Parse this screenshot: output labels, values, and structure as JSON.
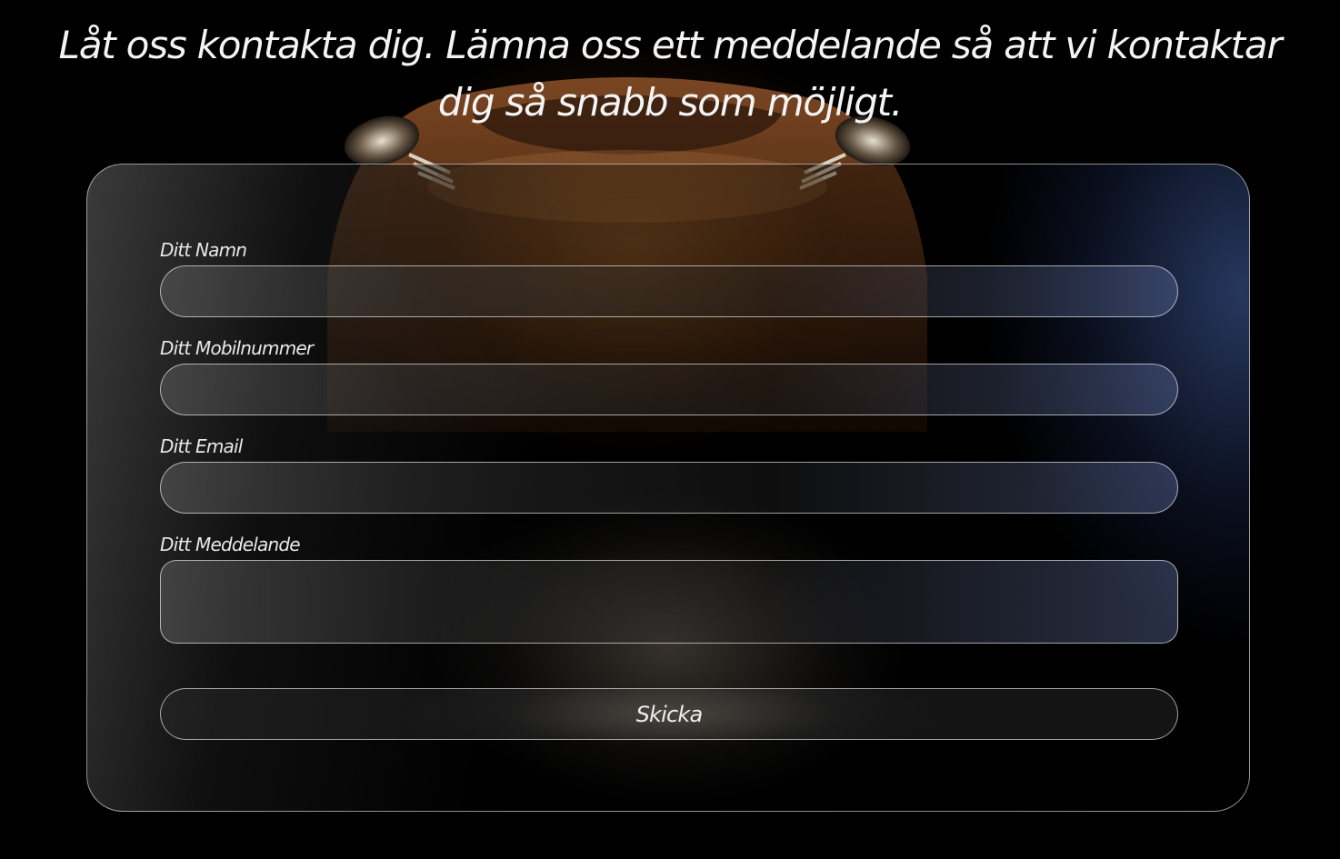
{
  "header": {
    "title": "Låt oss kontakta dig. Lämna oss ett meddelande så att vi kontaktar dig så snabb som möjligt."
  },
  "form": {
    "name_label": "Ditt Namn",
    "phone_label": "Ditt Mobilnummer",
    "email_label": "Ditt Email",
    "message_label": "Ditt Meddelande",
    "name_value": "",
    "phone_value": "",
    "email_value": "",
    "message_value": "",
    "submit_label": "Skicka"
  },
  "theme": {
    "background": "#000000",
    "text": "#f4f4f4",
    "accent_blue": "#4a66aa",
    "accent_copper": "#8c5528"
  },
  "icons": {
    "background_image": "sports-car-front"
  }
}
